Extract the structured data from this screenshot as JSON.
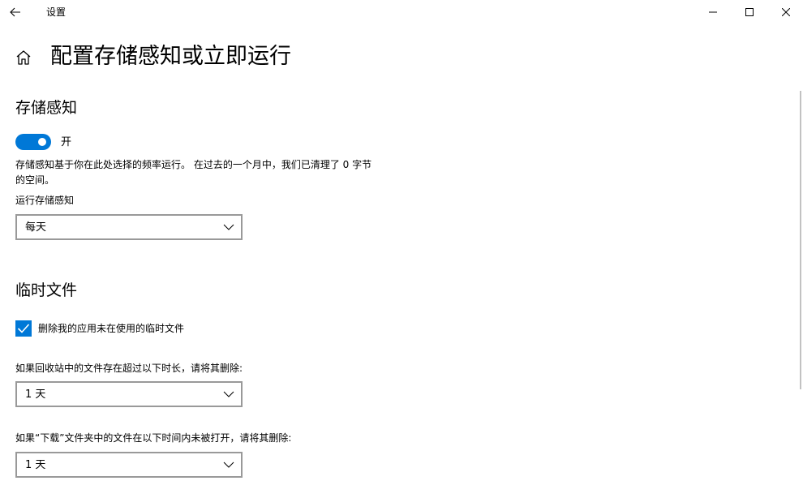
{
  "window": {
    "title": "设置",
    "back_icon": "arrow-left-icon",
    "controls": [
      "minimize-icon",
      "maximize-icon",
      "close-icon"
    ]
  },
  "header": {
    "home_icon": "home-icon",
    "title": "配置存储感知或立即运行"
  },
  "storage_sense": {
    "section_title": "存储感知",
    "toggle_state_label": "开",
    "toggle_on": true,
    "description": "存储感知基于你在此处选择的频率运行。 在过去的一个月中，我们已清理了 0 字节 的空间。",
    "run_label": "运行存储感知",
    "run_selected": "每天"
  },
  "temp_files": {
    "section_title": "临时文件",
    "delete_temp_label": "删除我的应用未在使用的临时文件",
    "delete_temp_checked": true,
    "recycle_label": "如果回收站中的文件存在超过以下时长，请将其删除:",
    "recycle_selected": "1 天",
    "downloads_label": "如果“下载”文件夹中的文件在以下时间内未被打开，请将其删除:",
    "downloads_selected": "1 天"
  },
  "colors": {
    "accent": "#0078d7",
    "border": "#999999"
  }
}
